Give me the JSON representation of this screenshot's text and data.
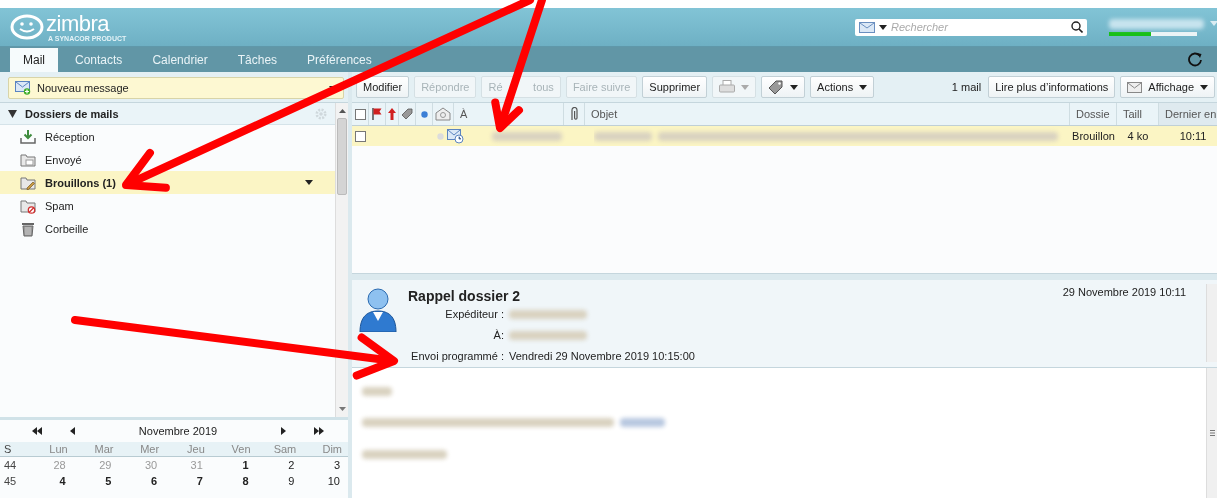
{
  "header": {
    "logo": {
      "name": "zimbra",
      "tagline": "A SYNACOR PRODUCT"
    },
    "search": {
      "placeholder": "Rechercher"
    },
    "quota": {
      "level": 0.48
    }
  },
  "tabs": [
    {
      "label": "Mail",
      "selected": true
    },
    {
      "label": "Contacts",
      "selected": false
    },
    {
      "label": "Calendrier",
      "selected": false
    },
    {
      "label": "Tâches",
      "selected": false
    },
    {
      "label": "Préférences",
      "selected": false
    }
  ],
  "new_message": {
    "label": "Nouveau message"
  },
  "folders": {
    "title": "Dossiers de mails",
    "items": [
      {
        "label": "Réception",
        "kind": "inbox",
        "selected": false
      },
      {
        "label": "Envoyé",
        "kind": "sent",
        "selected": false
      },
      {
        "label": "Brouillons (1)",
        "kind": "drafts",
        "selected": true
      },
      {
        "label": "Spam",
        "kind": "spam",
        "selected": false
      },
      {
        "label": "Corbeille",
        "kind": "trash",
        "selected": false
      }
    ]
  },
  "calendar": {
    "title": "Novembre 2019",
    "columns": [
      "S",
      "Lun",
      "Mar",
      "Mer",
      "Jeu",
      "Ven",
      "Sam",
      "Dim"
    ],
    "weeks": [
      {
        "week": "44",
        "days": [
          {
            "day": "28",
            "other_month": true
          },
          {
            "day": "29",
            "other_month": true
          },
          {
            "day": "30",
            "other_month": true
          },
          {
            "day": "31",
            "other_month": true
          },
          {
            "day": "1",
            "other_month": false
          },
          {
            "day": "2",
            "other_month": false
          },
          {
            "day": "3",
            "other_month": false
          }
        ]
      },
      {
        "week": "45",
        "days": [
          {
            "day": "4",
            "other_month": false
          },
          {
            "day": "5",
            "other_month": false
          },
          {
            "day": "6",
            "other_month": false
          },
          {
            "day": "7",
            "other_month": false
          },
          {
            "day": "8",
            "other_month": false
          },
          {
            "day": "9",
            "other_month": false
          },
          {
            "day": "10",
            "other_month": false
          }
        ]
      }
    ]
  },
  "toolbar": {
    "items": [
      {
        "kind": "button",
        "label": "Modifier",
        "disabled": false
      },
      {
        "kind": "button",
        "label": "Répondre",
        "disabled": true
      },
      {
        "kind": "button",
        "label": "Ré          tous",
        "disabled": true
      },
      {
        "kind": "button",
        "label": "Faire suivre",
        "disabled": true
      },
      {
        "kind": "button",
        "label": "Supprimer",
        "disabled": false
      },
      {
        "kind": "print",
        "disabled": true
      },
      {
        "kind": "tag",
        "disabled": false
      },
      {
        "kind": "menu",
        "label": "Actions",
        "disabled": false
      }
    ],
    "count": "1 mail",
    "info_button": "Lire plus d’informations",
    "view_button": "Affichage"
  },
  "table": {
    "select_all": {
      "checked": false
    },
    "columns": [
      "À",
      "Objet",
      "Dossie",
      "Taill",
      "Dernier en"
    ],
    "rows": [
      {
        "selected": true,
        "checked": false,
        "folder": "Brouillon",
        "size": "4 ko",
        "time": "10:11"
      }
    ]
  },
  "message": {
    "subject": "Rappel dossier 2",
    "date": "29 Novembre 2019 10:11",
    "fields": [
      {
        "label": "Expéditeur :",
        "kind": "blurred"
      },
      {
        "label": "À:",
        "kind": "blurred"
      },
      {
        "label": "Envoi programmé :",
        "kind": "text",
        "value": "Vendredi 29 Novembre 2019 10:15:00"
      }
    ]
  }
}
